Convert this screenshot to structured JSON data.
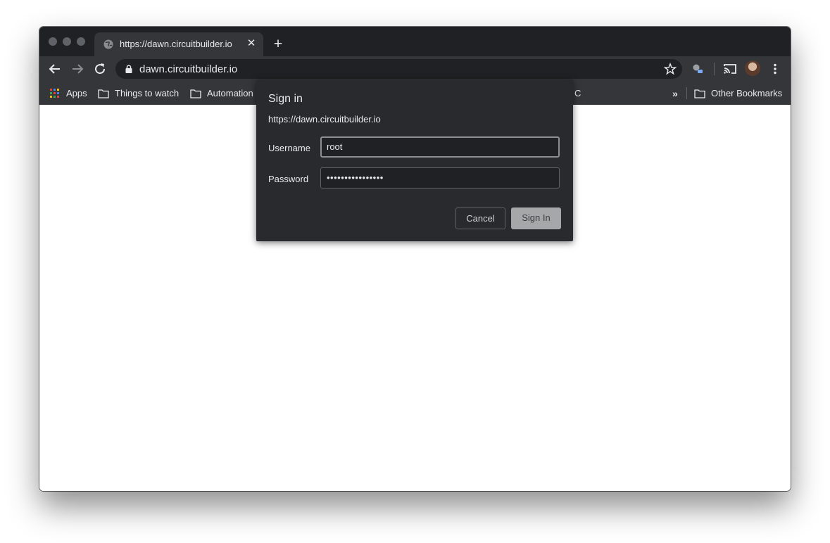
{
  "tab": {
    "title": "https://dawn.circuitbuilder.io",
    "favicon": "globe-icon"
  },
  "omnibox": {
    "url": "dawn.circuitbuilder.io"
  },
  "bookmarks": {
    "items": [
      {
        "label": "Apps",
        "icon": "apps-grid-icon"
      },
      {
        "label": "Things to watch",
        "icon": "folder-icon"
      },
      {
        "label": "Automation",
        "icon": "folder-icon"
      },
      {
        "label": "C",
        "icon": ""
      }
    ],
    "overflow": "»",
    "other": "Other Bookmarks"
  },
  "dialog": {
    "title": "Sign in",
    "origin": "https://dawn.circuitbuilder.io",
    "username_label": "Username",
    "username_value": "root",
    "password_label": "Password",
    "password_value": "••••••••••••••••",
    "cancel_label": "Cancel",
    "signin_label": "Sign In"
  },
  "colors": {
    "tabstrip": "#202124",
    "toolbar": "#35363a",
    "dialog": "#292a2d",
    "signin_button": "#a6a7a9"
  }
}
